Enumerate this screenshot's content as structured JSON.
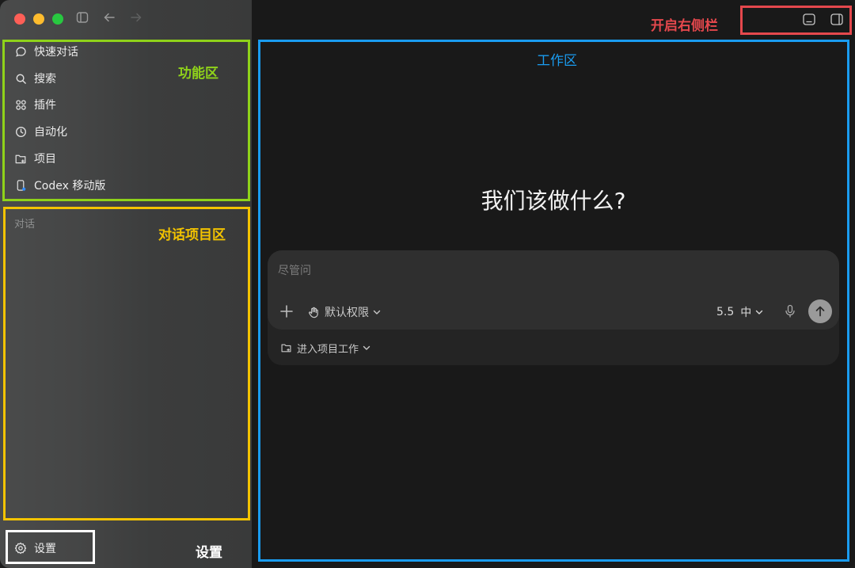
{
  "window": {
    "accent_colors": {
      "functions": "#8fd21a",
      "conversations": "#f3c300",
      "settings": "#ffffff",
      "workspace": "#1a9cf0",
      "toggle": "#e5484d"
    }
  },
  "titlebar": {
    "icons": [
      "sidebar-toggle-icon",
      "back-arrow-icon",
      "forward-arrow-icon"
    ]
  },
  "sidebar": {
    "nav_items": [
      {
        "label": "快速对话",
        "icon": "chat-bubble-icon"
      },
      {
        "label": "搜索",
        "icon": "search-icon"
      },
      {
        "label": "插件",
        "icon": "plugins-grid-icon"
      },
      {
        "label": "自动化",
        "icon": "clock-icon"
      },
      {
        "label": "项目",
        "icon": "folder-add-icon"
      },
      {
        "label": "Codex 移动版",
        "icon": "mobile-phone-icon"
      }
    ],
    "conversations_label": "对话",
    "settings_label": "设置"
  },
  "annotations": {
    "functions": "功能区",
    "conversations": "对话项目区",
    "settings": "设置",
    "workspace": "工作区",
    "toggle_right_sidebar": "开启右侧栏"
  },
  "main": {
    "hero_title": "我们该做什么?",
    "composer": {
      "placeholder": "尽管问",
      "permission_label": "默认权限",
      "model_version": "5.5",
      "model_effort": "中",
      "project_label": "进入项目工作"
    }
  }
}
